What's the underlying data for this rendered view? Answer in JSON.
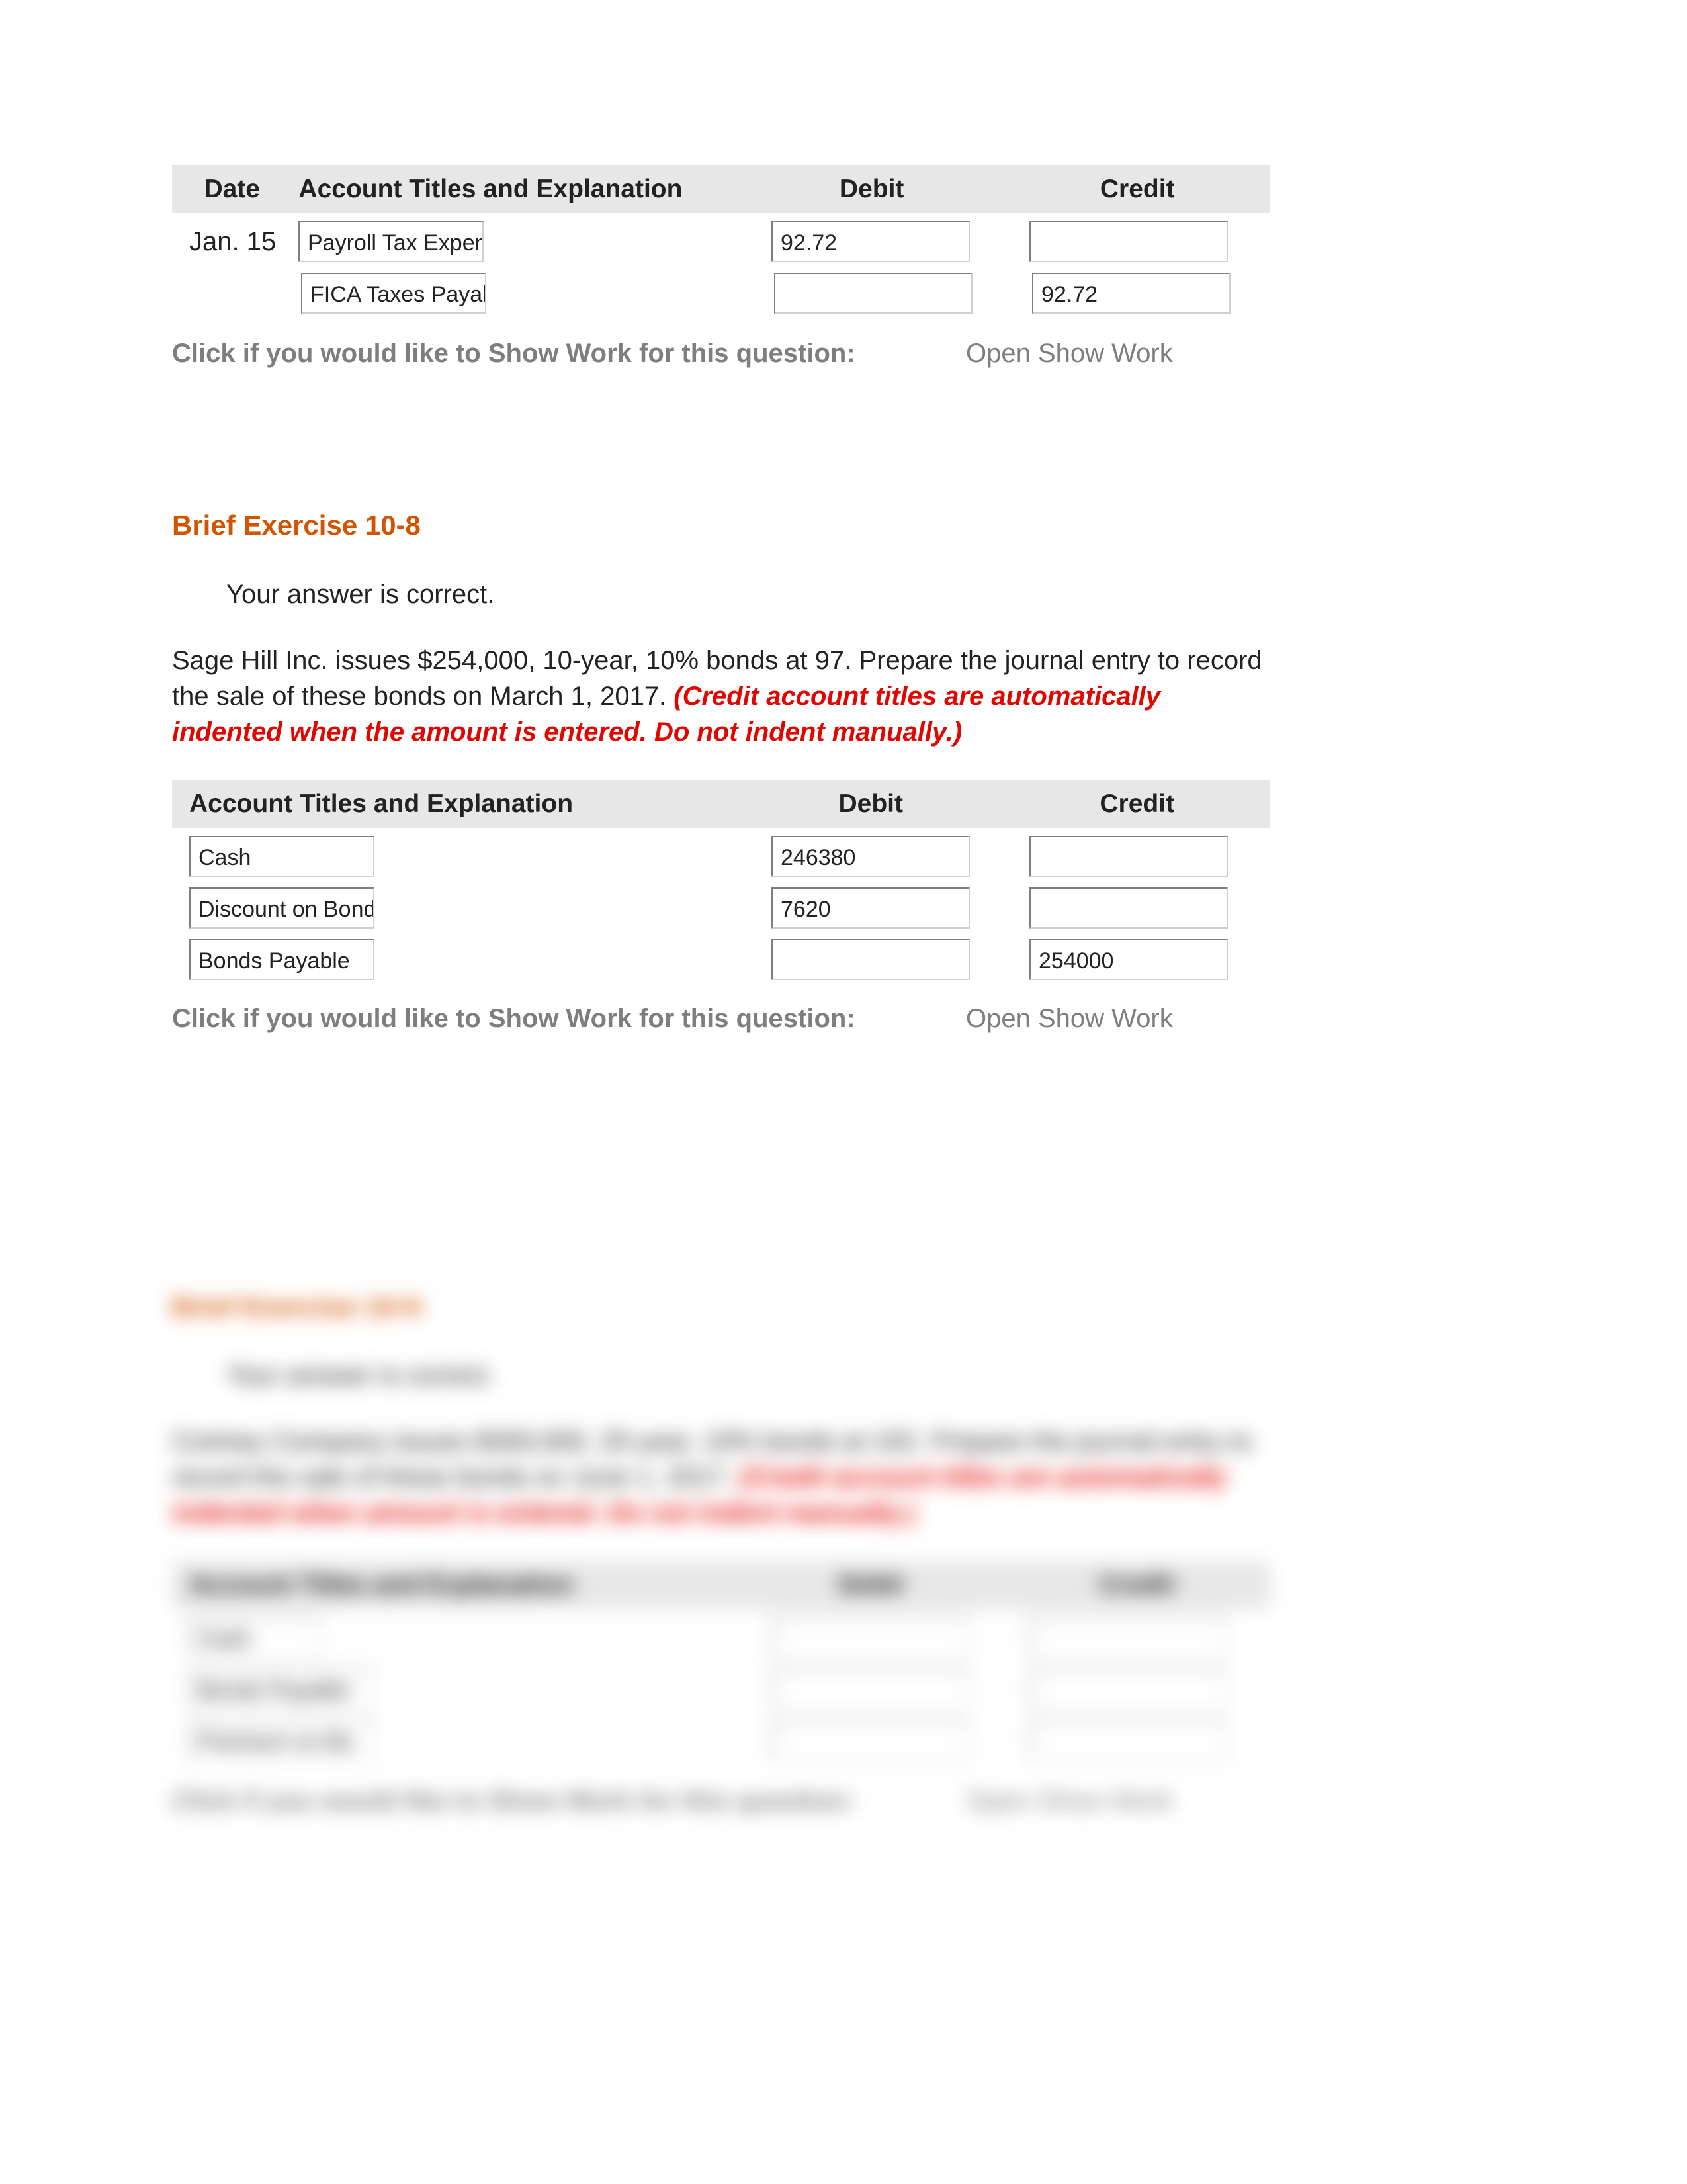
{
  "table1": {
    "headers": {
      "date": "Date",
      "acct": "Account Titles and Explanation",
      "debit": "Debit",
      "credit": "Credit"
    },
    "date": "Jan. 15",
    "rows": [
      {
        "acct": "Payroll Tax Expense",
        "debit": "92.72",
        "credit": ""
      },
      {
        "acct": "FICA Taxes Payable",
        "debit": "",
        "credit": "92.72"
      }
    ],
    "sw_prompt": "Click if you would like to Show Work for this question:",
    "sw_link": "Open Show Work"
  },
  "ex2": {
    "title": "Brief Exercise 10-8",
    "correct": "Your answer is correct.",
    "prompt_plain": "Sage Hill Inc. issues $254,000, 10-year, 10% bonds at 97. Prepare the journal entry to record the sale of these bonds on March 1, 2017. ",
    "prompt_note": "(Credit account titles are automatically indented when the amount is entered. Do not indent manually.)",
    "headers": {
      "acct": "Account Titles and Explanation",
      "debit": "Debit",
      "credit": "Credit"
    },
    "rows": [
      {
        "acct": "Cash",
        "debit": "246380",
        "credit": ""
      },
      {
        "acct": "Discount on Bonds",
        "debit": "7620",
        "credit": ""
      },
      {
        "acct": "Bonds Payable",
        "debit": "",
        "credit": "254000"
      }
    ],
    "sw_prompt": "Click if you would like to Show Work for this question:",
    "sw_link": "Open Show Work"
  },
  "ex3_blurred": {
    "title": "Brief Exercise 10-9",
    "correct": "Your answer is correct.",
    "prompt_plain": "Cortney Company issues $300,000, 20-year, 10% bonds at 102. Prepare the journal entry to record the sale of these bonds on June 1, 2017. ",
    "prompt_note": "(Credit account titles are automatically indented when amount is entered. Do not indent manually.)",
    "headers": {
      "acct": "Account Titles and Explanation",
      "debit": "Debit",
      "credit": "Credit"
    },
    "rows": [
      {
        "acct": "Cash",
        "debit": "",
        "credit": ""
      },
      {
        "acct": "Bonds Payable",
        "debit": "",
        "credit": ""
      },
      {
        "acct": "Premium on Bo",
        "debit": "",
        "credit": ""
      }
    ],
    "sw_prompt": "Click if you would like to Show Work for this question:",
    "sw_link": "Open Show Work"
  }
}
